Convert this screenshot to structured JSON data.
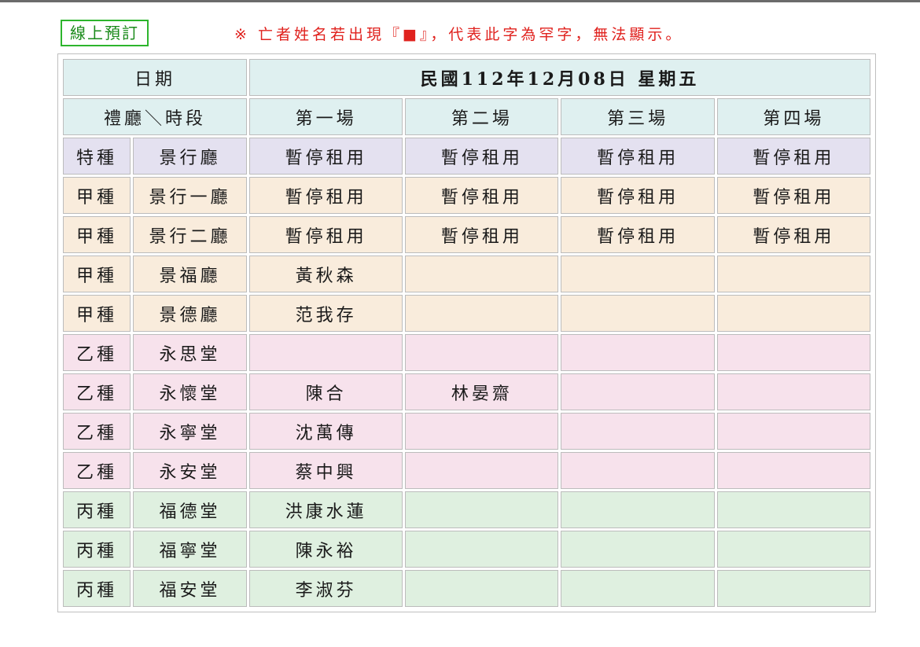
{
  "online_booking_label": "線上預訂",
  "notice": "※ 亡者姓名若出現『■』，代表此字為罕字，無法顯示。",
  "header": {
    "date_label": "日期",
    "date_value": "民國112年12月08日 星期五",
    "hall_slot_label": "禮廳＼時段",
    "slots": [
      "第一場",
      "第二場",
      "第三場",
      "第四場"
    ]
  },
  "rows": [
    {
      "type": "特種",
      "hall": "景行廳",
      "cells": [
        "暫停租用",
        "暫停租用",
        "暫停租用",
        "暫停租用"
      ]
    },
    {
      "type": "甲種",
      "hall": "景行一廳",
      "cells": [
        "暫停租用",
        "暫停租用",
        "暫停租用",
        "暫停租用"
      ]
    },
    {
      "type": "甲種",
      "hall": "景行二廳",
      "cells": [
        "暫停租用",
        "暫停租用",
        "暫停租用",
        "暫停租用"
      ]
    },
    {
      "type": "甲種",
      "hall": "景福廳",
      "cells": [
        "黃秋森",
        "",
        "",
        ""
      ]
    },
    {
      "type": "甲種",
      "hall": "景德廳",
      "cells": [
        "范我存",
        "",
        "",
        ""
      ]
    },
    {
      "type": "乙種",
      "hall": "永思堂",
      "cells": [
        "",
        "",
        "",
        ""
      ]
    },
    {
      "type": "乙種",
      "hall": "永懷堂",
      "cells": [
        "陳合",
        "林晏齋",
        "",
        ""
      ]
    },
    {
      "type": "乙種",
      "hall": "永寧堂",
      "cells": [
        "沈萬傳",
        "",
        "",
        ""
      ]
    },
    {
      "type": "乙種",
      "hall": "永安堂",
      "cells": [
        "蔡中興",
        "",
        "",
        ""
      ]
    },
    {
      "type": "丙種",
      "hall": "福德堂",
      "cells": [
        "洪康水蓮",
        "",
        "",
        ""
      ]
    },
    {
      "type": "丙種",
      "hall": "福寧堂",
      "cells": [
        "陳永裕",
        "",
        "",
        ""
      ]
    },
    {
      "type": "丙種",
      "hall": "福安堂",
      "cells": [
        "李淑芬",
        "",
        "",
        ""
      ]
    }
  ],
  "colors": {
    "header_bg": "#dff0f0",
    "special_bg": "#e4e1f0",
    "class_a_bg": "#f9ecdc",
    "class_b_bg": "#f7e2ec",
    "class_c_bg": "#dff0e0",
    "notice_red": "#e0221e",
    "button_green": "#2db52d"
  }
}
